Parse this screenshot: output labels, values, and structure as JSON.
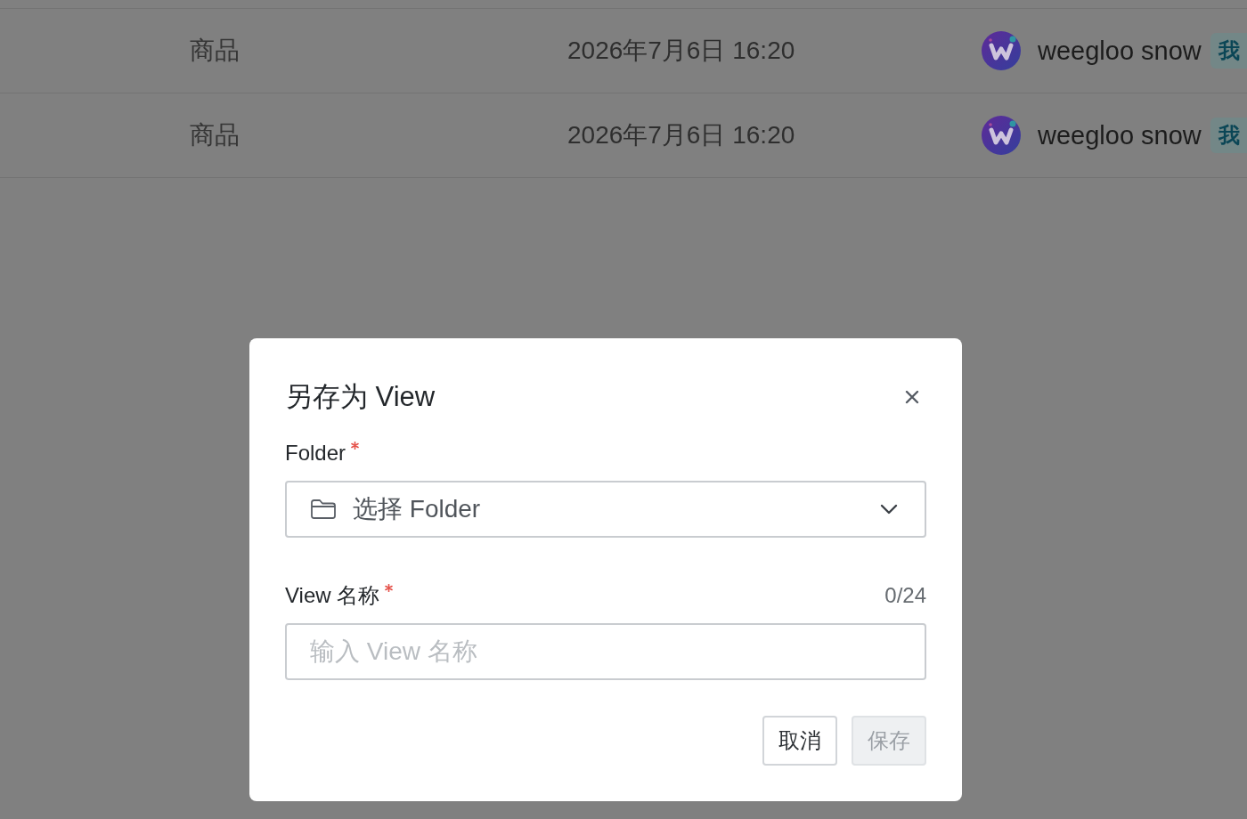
{
  "table": {
    "rows": [
      {
        "column_1": "商品",
        "column_2": "2026年7月6日 16:20",
        "column_3": {
          "name": "weegloo snow",
          "badge": "我"
        }
      },
      {
        "column_1": "商品",
        "column_2": "2026年7月6日 16:20",
        "column_3": {
          "name": "weegloo snow",
          "badge": "我"
        }
      }
    ]
  },
  "dialog": {
    "title": "另存为 View",
    "fields": [
      {
        "kind": "select",
        "label": "Folder",
        "required": true,
        "placeholder": "选择 Folder"
      },
      {
        "kind": "text",
        "label": "View 名称",
        "required": true,
        "counter": "0/24",
        "placeholder": "输入 View 名称"
      }
    ],
    "buttons": [
      {
        "label": "取消",
        "disabled": false
      },
      {
        "label": "保存",
        "disabled": true
      }
    ]
  }
}
